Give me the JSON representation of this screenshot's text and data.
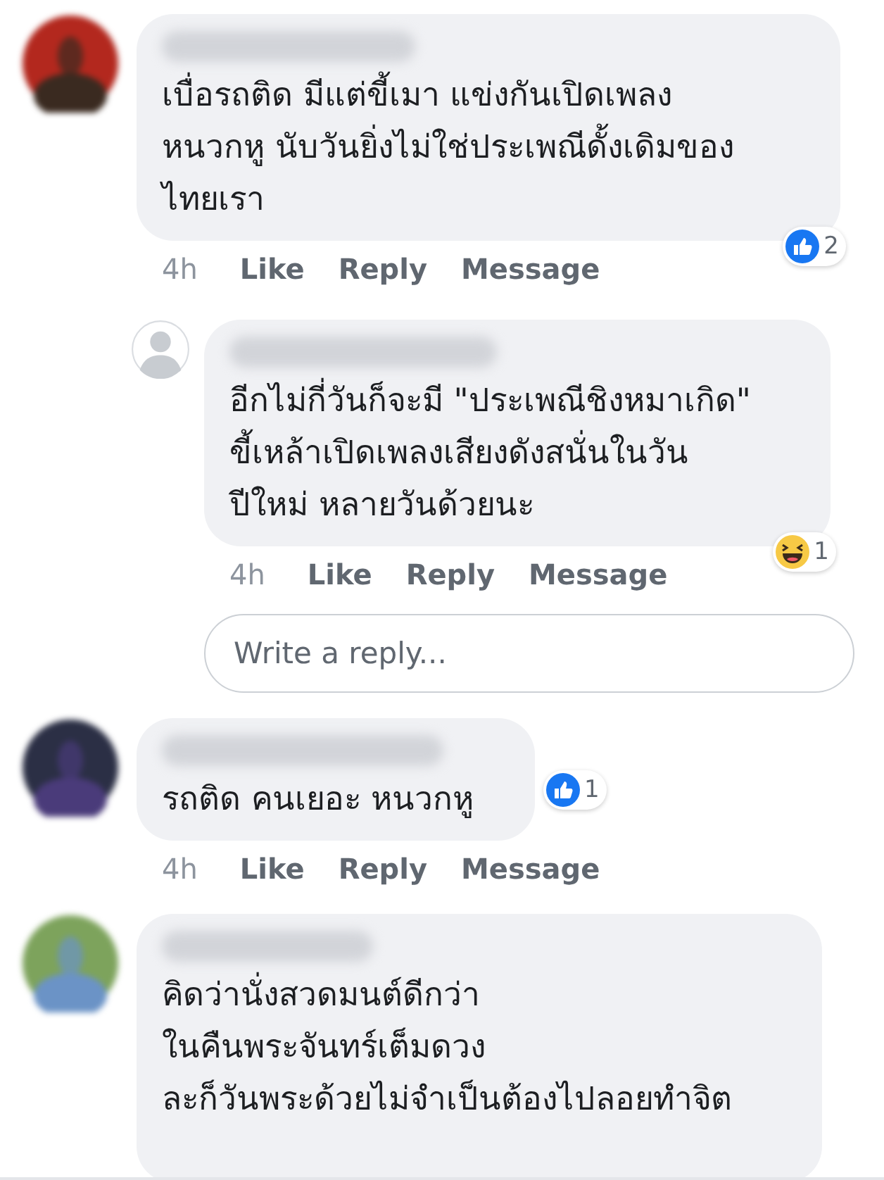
{
  "comments": [
    {
      "photo_avatar": true,
      "lines": [
        "เบื่อรถติด มีแต่ขี้เมา แข่งกันเปิดเพลง",
        "หนวกหู นับวันยิ่งไม่ใช่ประเพณีดั้งเดิมของ",
        "ไทยเรา"
      ],
      "reaction": {
        "kind": "like",
        "count": "2",
        "beside_bubble": false
      },
      "time": "4h",
      "actions": [
        "Like",
        "Reply",
        "Message"
      ],
      "replies": [
        {
          "photo_avatar": false,
          "lines": [
            "อีกไม่กี่วันก็จะมี \"ประเพณีชิงหมาเกิด\"",
            "ขี้เหล้าเปิดเพลงเสียงดังสนั่นในวัน",
            "ปีใหม่ หลายวันด้วยนะ"
          ],
          "reaction": {
            "kind": "haha",
            "count": "1",
            "beside_bubble": false
          },
          "time": "4h",
          "actions": [
            "Like",
            "Reply",
            "Message"
          ]
        }
      ],
      "reply_field": {
        "placeholder": "Write a reply..."
      }
    },
    {
      "photo_avatar": true,
      "lines": [
        "รถติด คนเยอะ หนวกหู"
      ],
      "reaction": {
        "kind": "like",
        "count": "1",
        "beside_bubble": true
      },
      "time": "4h",
      "actions": [
        "Like",
        "Reply",
        "Message"
      ]
    },
    {
      "photo_avatar": true,
      "lines": [
        "คิดว่านั่งสวดมนต์ดีกว่า",
        "ในคืนพระจันทร์เต็มดวง",
        "ละก็วันพระด้วยไม่จำเป็นต้องไปลอยทำจิต"
      ]
    }
  ]
}
